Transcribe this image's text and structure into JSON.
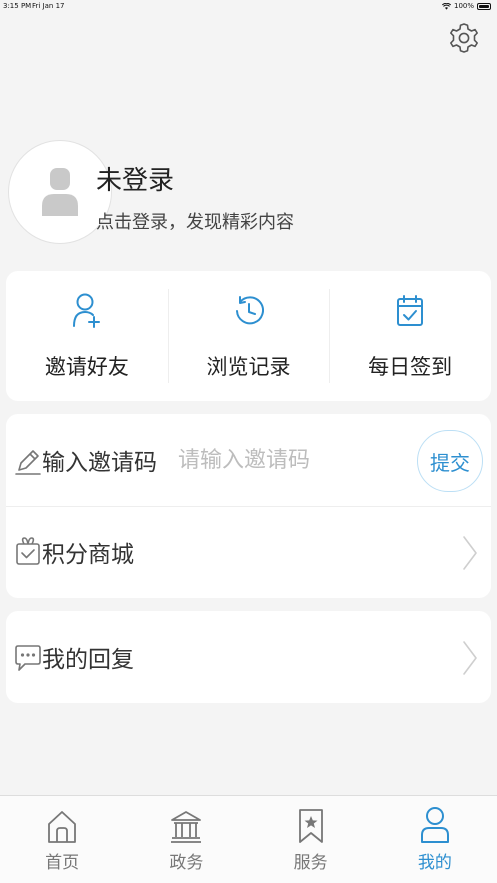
{
  "status_bar": {
    "time": "3:15 PM",
    "date": "Fri Jan 17",
    "battery": "100%"
  },
  "settings": {
    "icon": "gear-icon"
  },
  "profile": {
    "name": "未登录",
    "hint": "点击登录，发现精彩内容",
    "avatar_icon": "user-avatar-icon"
  },
  "quick_actions": [
    {
      "label": "邀请好友",
      "icon": "add-user-icon"
    },
    {
      "label": "浏览记录",
      "icon": "history-clock-icon"
    },
    {
      "label": "每日签到",
      "icon": "calendar-check-icon"
    }
  ],
  "invite": {
    "label": "输入邀请码",
    "placeholder": "请输入邀请码",
    "submit_label": "提交",
    "icon": "pencil-icon"
  },
  "mall": {
    "label": "积分商城",
    "icon": "gift-icon"
  },
  "reply": {
    "label": "我的回复",
    "icon": "chat-bubble-icon"
  },
  "tabs": [
    {
      "label": "首页",
      "icon": "home-icon",
      "active": false
    },
    {
      "label": "政务",
      "icon": "government-building-icon",
      "active": false
    },
    {
      "label": "服务",
      "icon": "bookmark-star-icon",
      "active": false
    },
    {
      "label": "我的",
      "icon": "person-icon",
      "active": true
    }
  ],
  "colors": {
    "accent": "#2d8fd0",
    "background": "#f4f4f4",
    "card": "#ffffff",
    "inactive": "#777777"
  }
}
